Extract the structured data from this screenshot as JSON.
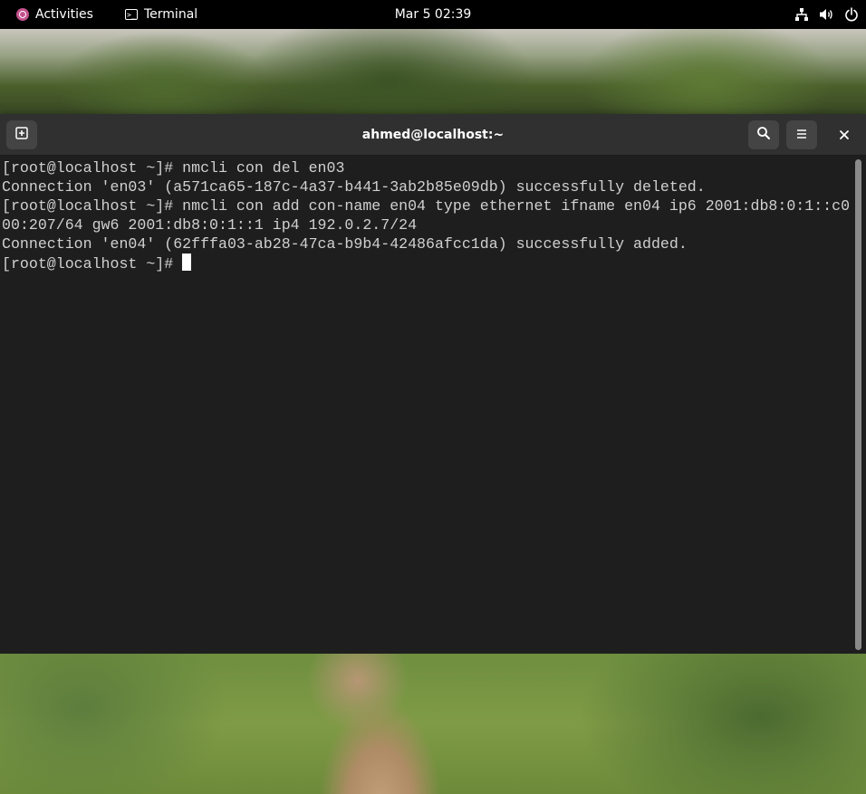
{
  "top_bar": {
    "activities_label": "Activities",
    "app_menu_label": "Terminal",
    "clock": "Mar 5  02:39",
    "tray_icons": [
      "network-icon",
      "volume-icon",
      "power-icon"
    ]
  },
  "window": {
    "title": "ahmed@localhost:~",
    "buttons": [
      "new-tab-icon",
      "search-icon",
      "hamburger-menu-icon",
      "close-icon"
    ]
  },
  "terminal": {
    "lines": [
      "[root@localhost ~]# nmcli con del en03",
      "Connection 'en03' (a571ca65-187c-4a37-b441-3ab2b85e09db) successfully deleted.",
      "[root@localhost ~]# nmcli con add con-name en04 type ethernet ifname en04 ip6 2001:db8:0:1::c0",
      "00:207/64 gw6 2001:db8:0:1::1 ip4 192.0.2.7/24",
      "Connection 'en04' (62fffa03-ab28-47ca-b9b4-42486afcc1da) successfully added.",
      "[root@localhost ~]# "
    ]
  },
  "colors": {
    "top_bar": "#000000",
    "header_bar": "#303030",
    "terminal_bg": "#1e1e1e",
    "terminal_fg": "#d0d0d0",
    "fedora_logo": "#c4528f"
  }
}
